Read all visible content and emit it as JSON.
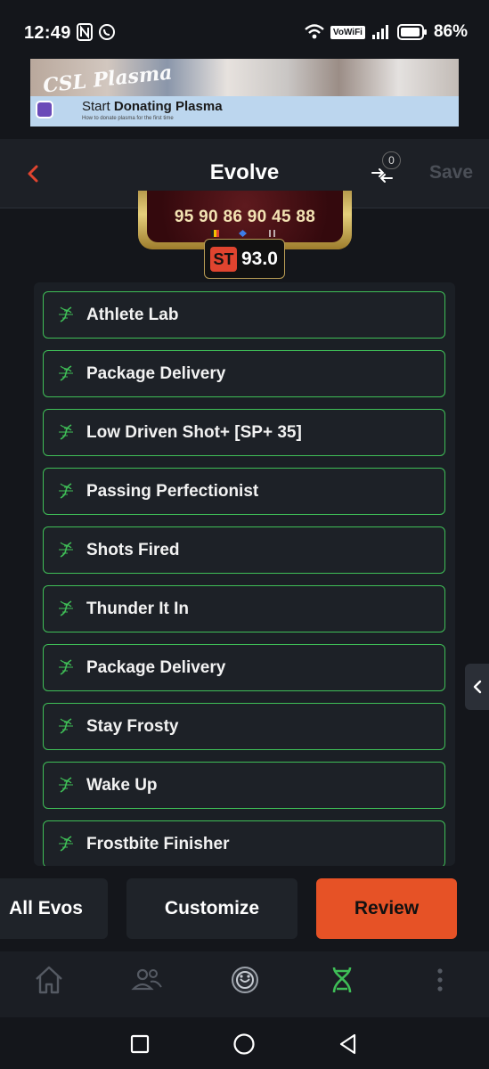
{
  "status_bar": {
    "time": "12:49",
    "network_label": "VoWiFi",
    "battery": "86%"
  },
  "ad": {
    "logo_text": "CSL Plasma",
    "title_prefix": "Start ",
    "title_bold": "Donating Plasma",
    "subtitle": "How to donate plasma for the first time"
  },
  "header": {
    "title": "Evolve",
    "compare_count": "0",
    "save_label": "Save"
  },
  "player_card": {
    "stats": "95 90 86 90 45 88",
    "position": "ST",
    "rating": "93.0"
  },
  "evolutions": [
    {
      "label": "Athlete Lab"
    },
    {
      "label": "Package Delivery"
    },
    {
      "label": "Low Driven Shot+ [SP+ 35]"
    },
    {
      "label": "Passing Perfectionist"
    },
    {
      "label": "Shots Fired"
    },
    {
      "label": "Thunder It In"
    },
    {
      "label": "Package Delivery"
    },
    {
      "label": "Stay Frosty"
    },
    {
      "label": "Wake Up"
    },
    {
      "label": "Frostbite Finisher"
    }
  ],
  "actions": {
    "all_evos": "All Evos",
    "customize": "Customize",
    "review": "Review"
  },
  "colors": {
    "accent_green": "#3fbf57",
    "review_orange": "#e65226",
    "back_red": "#e0442f"
  }
}
